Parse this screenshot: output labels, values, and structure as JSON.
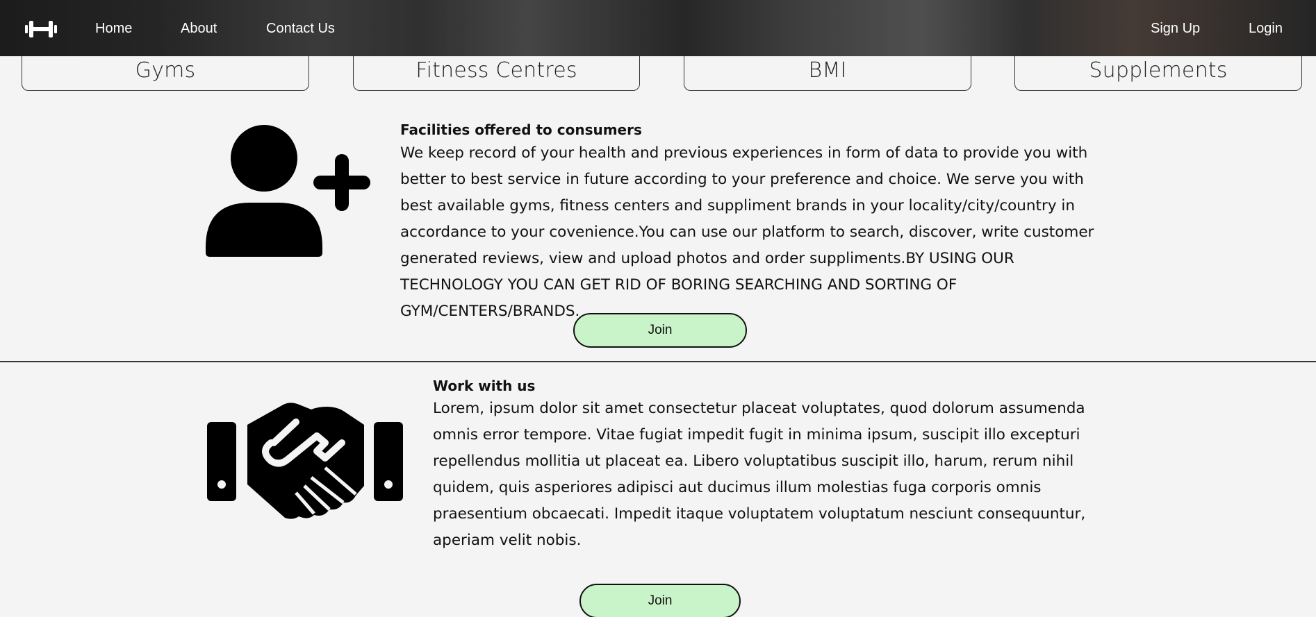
{
  "nav": {
    "logo_icon": "dumbbell-icon",
    "links": [
      "Home",
      "About",
      "Contact Us"
    ],
    "auth": [
      "Sign Up",
      "Login"
    ]
  },
  "categories": [
    "Gyms",
    "Fitness Centres",
    "BMI",
    "Supplements"
  ],
  "consumers": {
    "icon": "user-plus-icon",
    "title": "Facilities offered to consumers",
    "text": "We keep record of your health and previous experiences in form of data to provide you with better to best service in future according to your preference and choice. We serve you with best available gyms, fitness centers and suppliment brands in your locality/city/country in accordance to your covenience.You can use our platform to search, discover, write customer generated reviews, view and upload photos and order suppliments.BY USING OUR TECHNOLOGY YOU CAN GET RID OF BORING SEARCHING AND SORTING OF GYM/CENTERS/BRANDS.",
    "button": "Join"
  },
  "work": {
    "icon": "handshake-icon",
    "title": "Work with us",
    "text": "Lorem, ipsum dolor sit amet consectetur placeat voluptates, quod dolorum assumenda omnis error tempore. Vitae fugiat impedit fugit in minima ipsum, suscipit illo excepturi repellendus mollitia ut placeat ea. Libero voluptatibus suscipit illo, harum, rerum nihil quidem, quis asperiores adipisci aut ducimus illum molestias fuga corporis omnis praesentium obcaecati. Impedit itaque voluptatem voluptatum nesciunt consequuntur, aperiam velit nobis.",
    "button": "Join"
  },
  "colors": {
    "join_button_bg": "#c9f3c9",
    "page_bg": "#f4f4f4",
    "text": "#111111"
  }
}
